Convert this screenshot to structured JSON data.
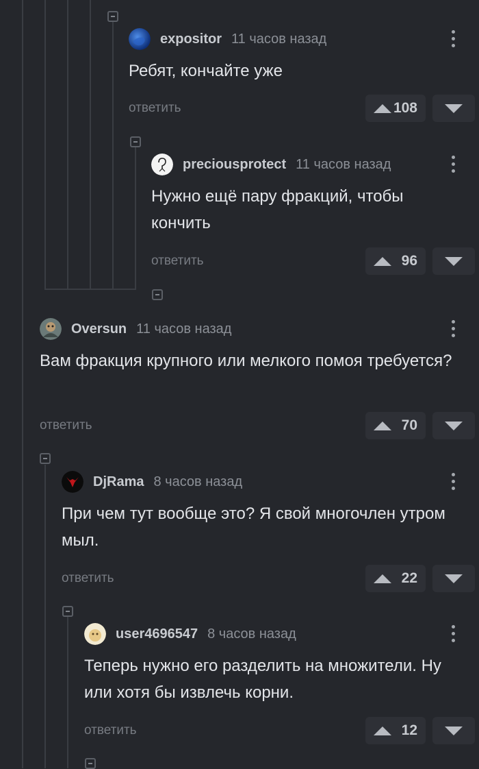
{
  "reply_label": "ответить",
  "comments": [
    {
      "author": "expositor",
      "time": "11 часов назад",
      "text": "Ребят, кончайте уже",
      "votes": "108"
    },
    {
      "author": "preciousprotect",
      "time": "11 часов назад",
      "text": "Нужно ещё пару фракций, чтобы кончить",
      "votes": "96"
    },
    {
      "author": "Oversun",
      "time": "11 часов назад",
      "text": "Вам фракция крупного или мелкого помоя требуется?",
      "votes": "70"
    },
    {
      "author": "DjRama",
      "time": "8 часов назад",
      "text": "При чем тут вообще это? Я свой многочлен утром мыл.",
      "votes": "22"
    },
    {
      "author": "user4696547",
      "time": "8 часов назад",
      "text": "Теперь нужно его разделить на множители. Ну или хотя бы извлечь корни.",
      "votes": "12"
    }
  ],
  "colors": {
    "background": "#25272c",
    "thread_line": "#3a3d43",
    "vote_box": "#2e3036"
  }
}
